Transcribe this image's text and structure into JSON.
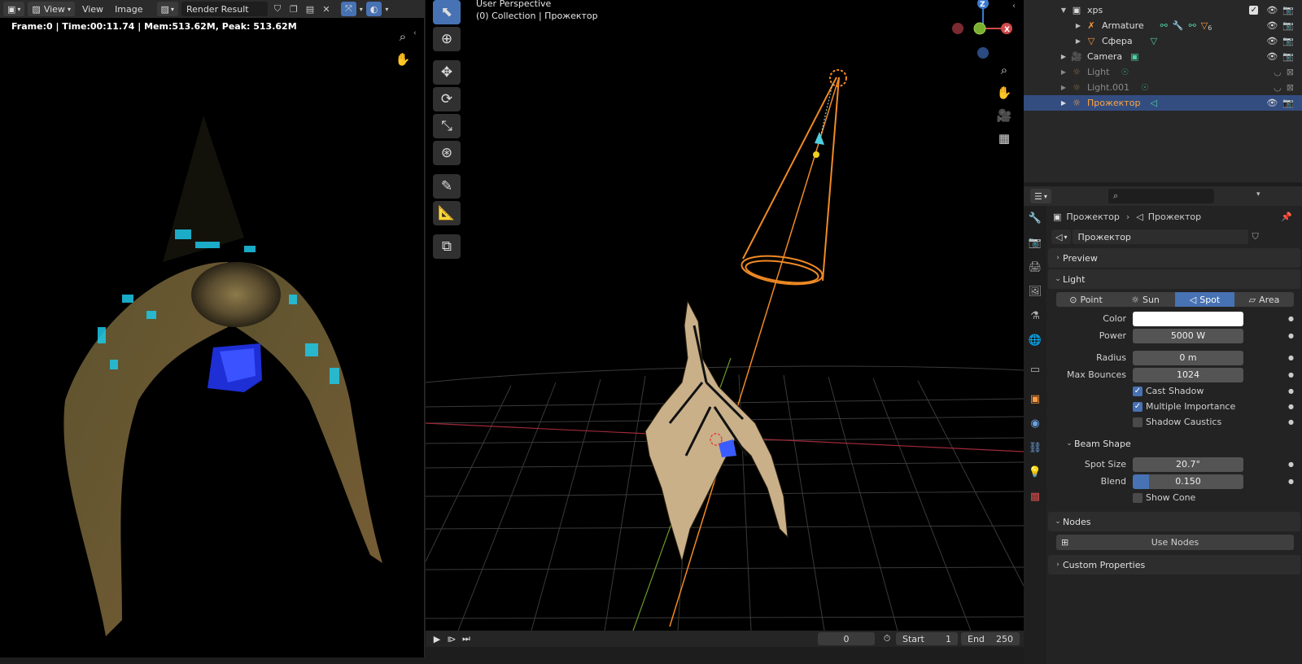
{
  "image_editor": {
    "header": {
      "view_menu_1": "View",
      "view_menu_2": "View",
      "image_menu": "Image",
      "image_name": "Render Result"
    },
    "render_info": "Frame:0 | Time:00:11.74 | Mem:513.62M, Peak: 513.62M"
  },
  "viewport": {
    "title": "User Perspective",
    "collection": "(0) Collection | Прожектор",
    "gizmo": {
      "z": "Z",
      "x": "X"
    }
  },
  "timeline": {
    "current_frame": "0",
    "start_label": "Start",
    "start_value": "1",
    "end_label": "End",
    "end_value": "250"
  },
  "outliner": {
    "rows": [
      {
        "label": "xps"
      },
      {
        "label": "Armature",
        "badge": "6"
      },
      {
        "label": "Сфера"
      },
      {
        "label": "Camera"
      },
      {
        "label": "Light"
      },
      {
        "label": "Light.001"
      },
      {
        "label": "Прожектор"
      }
    ]
  },
  "properties": {
    "breadcrumb_object": "Прожектор",
    "breadcrumb_data": "Прожектор",
    "datablock_name": "Прожектор",
    "panels": {
      "preview": "Preview",
      "light": "Light",
      "beam_shape": "Beam Shape",
      "nodes": "Nodes",
      "custom_properties": "Custom Properties"
    },
    "light_types": [
      "Point",
      "Sun",
      "Spot",
      "Area"
    ],
    "light_type_selected": "Spot",
    "color_label": "Color",
    "color_value": "#ffffff",
    "power_label": "Power",
    "power_value": "5000 W",
    "radius_label": "Radius",
    "radius_value": "0 m",
    "max_bounces_label": "Max Bounces",
    "max_bounces_value": "1024",
    "cast_shadow_label": "Cast Shadow",
    "multiple_importance_label": "Multiple Importance",
    "shadow_caustics_label": "Shadow Caustics",
    "spot_size_label": "Spot Size",
    "spot_size_value": "20.7°",
    "blend_label": "Blend",
    "blend_value": "0.150",
    "blend_fraction": 0.15,
    "show_cone_label": "Show Cone",
    "use_nodes_label": "Use Nodes"
  },
  "colors": {
    "accent": "#4772b3",
    "selected_object": "#ffa640",
    "light_cone": "#f08a24"
  }
}
